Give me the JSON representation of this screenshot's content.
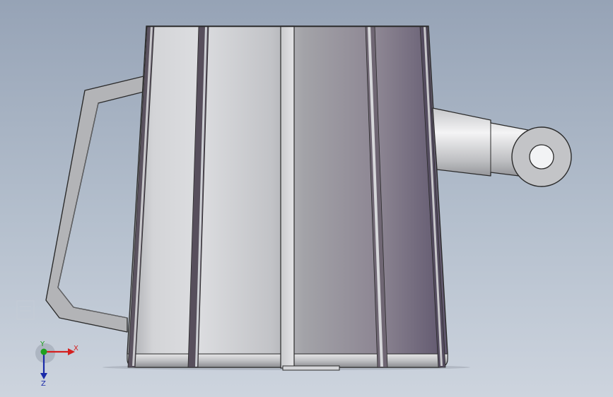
{
  "view": {
    "background_top": "#96a3b6",
    "background_bottom": "#cdd4de",
    "model": "mug-with-handle-and-pivot-arm"
  },
  "triad": {
    "x_label": "X",
    "y_label": "Y",
    "z_label": "Z",
    "x_color": "#d42020",
    "y_color": "#1ea01e",
    "z_color": "#1a2aa8"
  }
}
